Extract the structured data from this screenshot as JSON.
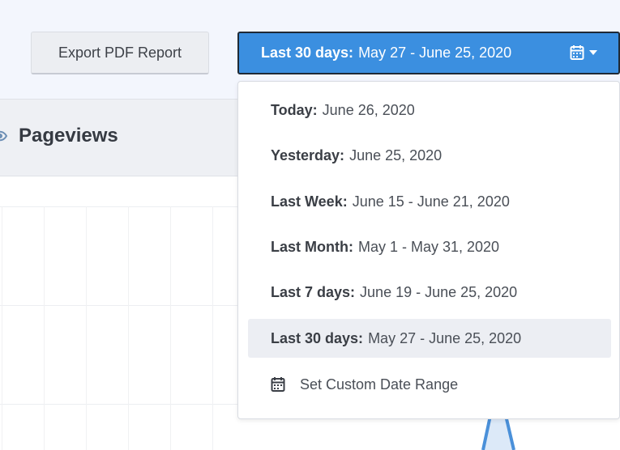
{
  "toolbar": {
    "export_label": "Export PDF Report",
    "date_range": {
      "label": "Last 30 days:",
      "value": "May 27 - June 25, 2020"
    }
  },
  "section": {
    "title": "Pageviews"
  },
  "dropdown": {
    "items": [
      {
        "label": "Today:",
        "value": "June 26, 2020",
        "active": false
      },
      {
        "label": "Yesterday:",
        "value": "June 25, 2020",
        "active": false
      },
      {
        "label": "Last Week:",
        "value": "June 15 - June 21, 2020",
        "active": false
      },
      {
        "label": "Last Month:",
        "value": "May 1 - May 31, 2020",
        "active": false
      },
      {
        "label": "Last 7 days:",
        "value": "June 19 - June 25, 2020",
        "active": false
      },
      {
        "label": "Last 30 days:",
        "value": "May 27 - June 25, 2020",
        "active": true
      }
    ],
    "custom_label": "Set Custom Date Range"
  },
  "icons": {
    "date_button": "calendar-icon",
    "date_caret": "caret-down-icon",
    "section": "eye-icon",
    "custom": "calendar-icon"
  },
  "colors": {
    "accent": "#3b8fe0",
    "active_item_bg": "#eceef3",
    "chart_line": "#4a90d9"
  }
}
